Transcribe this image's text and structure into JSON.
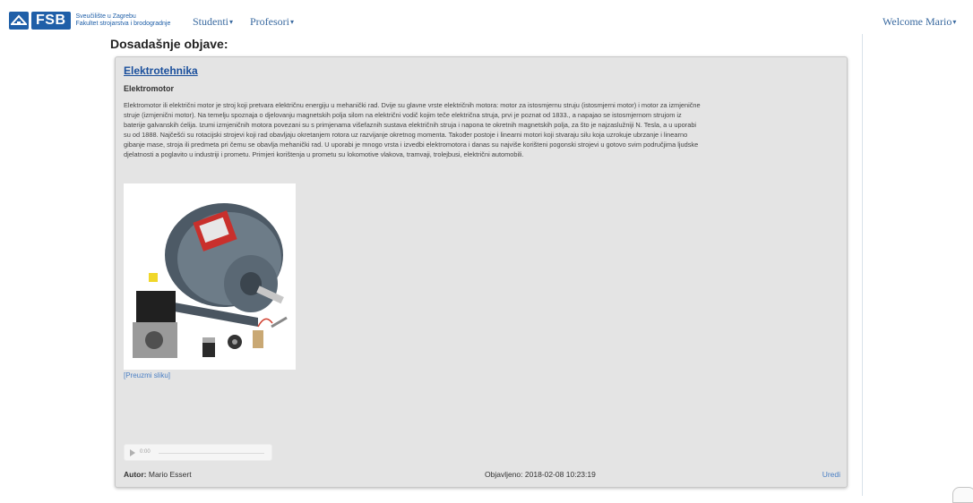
{
  "navbar": {
    "logo_word": "FSB",
    "logo_line1": "Sveučilište u Zagrebu",
    "logo_line2": "Fakultet strojarstva i brodogradnje",
    "menu": [
      {
        "label": "Studenti",
        "icon": "caret-down-icon"
      },
      {
        "label": "Profesori",
        "icon": "caret-down-icon"
      }
    ],
    "welcome": "Welcome Mario",
    "colors": {
      "brand": "#1f5fa8",
      "link": "#3a6aa0"
    }
  },
  "page": {
    "title": "Dosadašnje objave:"
  },
  "post": {
    "title": "Elektrotehnika",
    "subtitle": "Elektromotor",
    "body": "Elektromotor ili električni motor je stroj koji pretvara električnu energiju u mehanički rad. Dvije su glavne vrste električnih motora: motor za istosmjernu struju (istosmjerni motor) i motor za izmjenične struje (izmjenični motor). Na temelju spoznaja o djelovanju magnetskih polja silom na električni vodič kojim teče električna struja, prvi je poznat od 1833., a napajao se istosmjernom strujom iz baterije galvanskih ćelija. Izumi izmjeničnih motora povezani su s primjenama višefaznih sustava električnih struja i napona te okretnih magnetskih polja, za što je najzaslužniji N. Tesla, a u uporabi su od 1888. Najčešći su rotacijski strojevi koji rad obavljaju okretanjem rotora uz razvijanje okretnog momenta. Također postoje i linearni motori koji stvaraju silu koja uzrokuje ubrzanje i linearno gibanje mase, stroja ili predmeta pri čemu se obavlja mehanički rad. U uporabi je mnogo vrsta i izvedbi elektromotora i danas su najviše korišteni pogonski strojevi u gotovo svim područjima ljudske djelatnosti a poglavito u industriji i prometu. Primjeri korištenja u prometu su lokomotive vlakova, tramvaji, trolejbusi, električni automobili.",
    "image_icon": "electric-motor-photo",
    "download_label": "[Preuzmi sliku]",
    "audio": {
      "time": "0:00"
    },
    "author_label": "Autor:",
    "author": "Mario Essert",
    "published_label": "Objavljeno:",
    "published": "2018-02-08 10:23:19",
    "edit_label": "Uredi",
    "colors": {
      "card_bg": "#e4e4e4",
      "title": "#1a4f9c",
      "link": "#4a7fc4"
    }
  }
}
